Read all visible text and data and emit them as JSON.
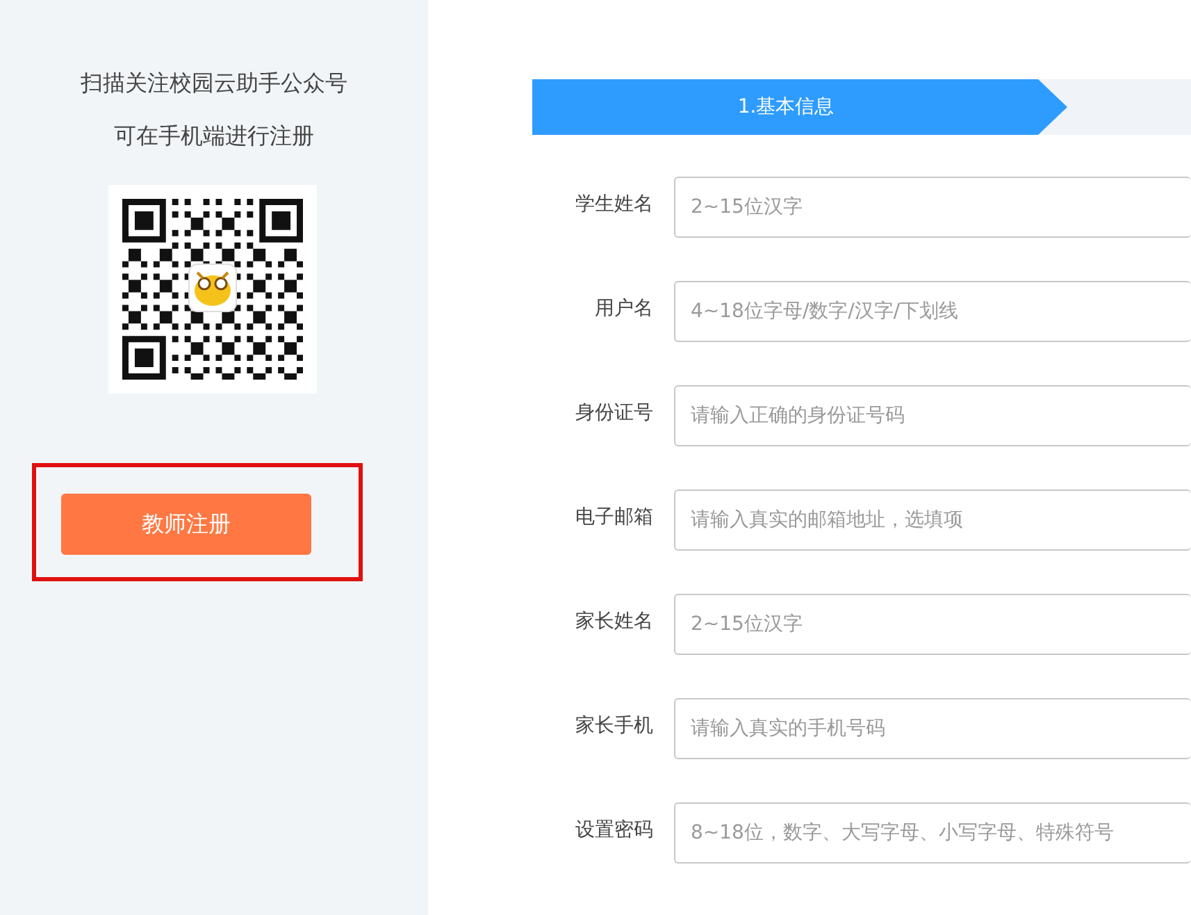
{
  "sidebar": {
    "lines": [
      "扫描关注校园云助手公众号",
      "可在手机端进行注册"
    ],
    "button": {
      "label": "教师注册",
      "highlighted": true
    }
  },
  "steps": [
    {
      "label": "1.基本信息",
      "selected": true
    }
  ],
  "form": {
    "fields": [
      {
        "label": "学生姓名",
        "placeholder": "2~15位汉字"
      },
      {
        "label": "用户名",
        "placeholder": "4~18位字母/数字/汉字/下划线"
      },
      {
        "label": "身份证号",
        "placeholder": "请输入正确的身份证号码"
      },
      {
        "label": "电子邮箱",
        "placeholder": "请输入真实的邮箱地址，选填项"
      },
      {
        "label": "家长姓名",
        "placeholder": "2~15位汉字"
      },
      {
        "label": "家长手机",
        "placeholder": "请输入真实的手机号码"
      },
      {
        "label": "设置密码",
        "placeholder": "8~18位，数字、大写字母、小写字母、特殊符号"
      }
    ]
  }
}
